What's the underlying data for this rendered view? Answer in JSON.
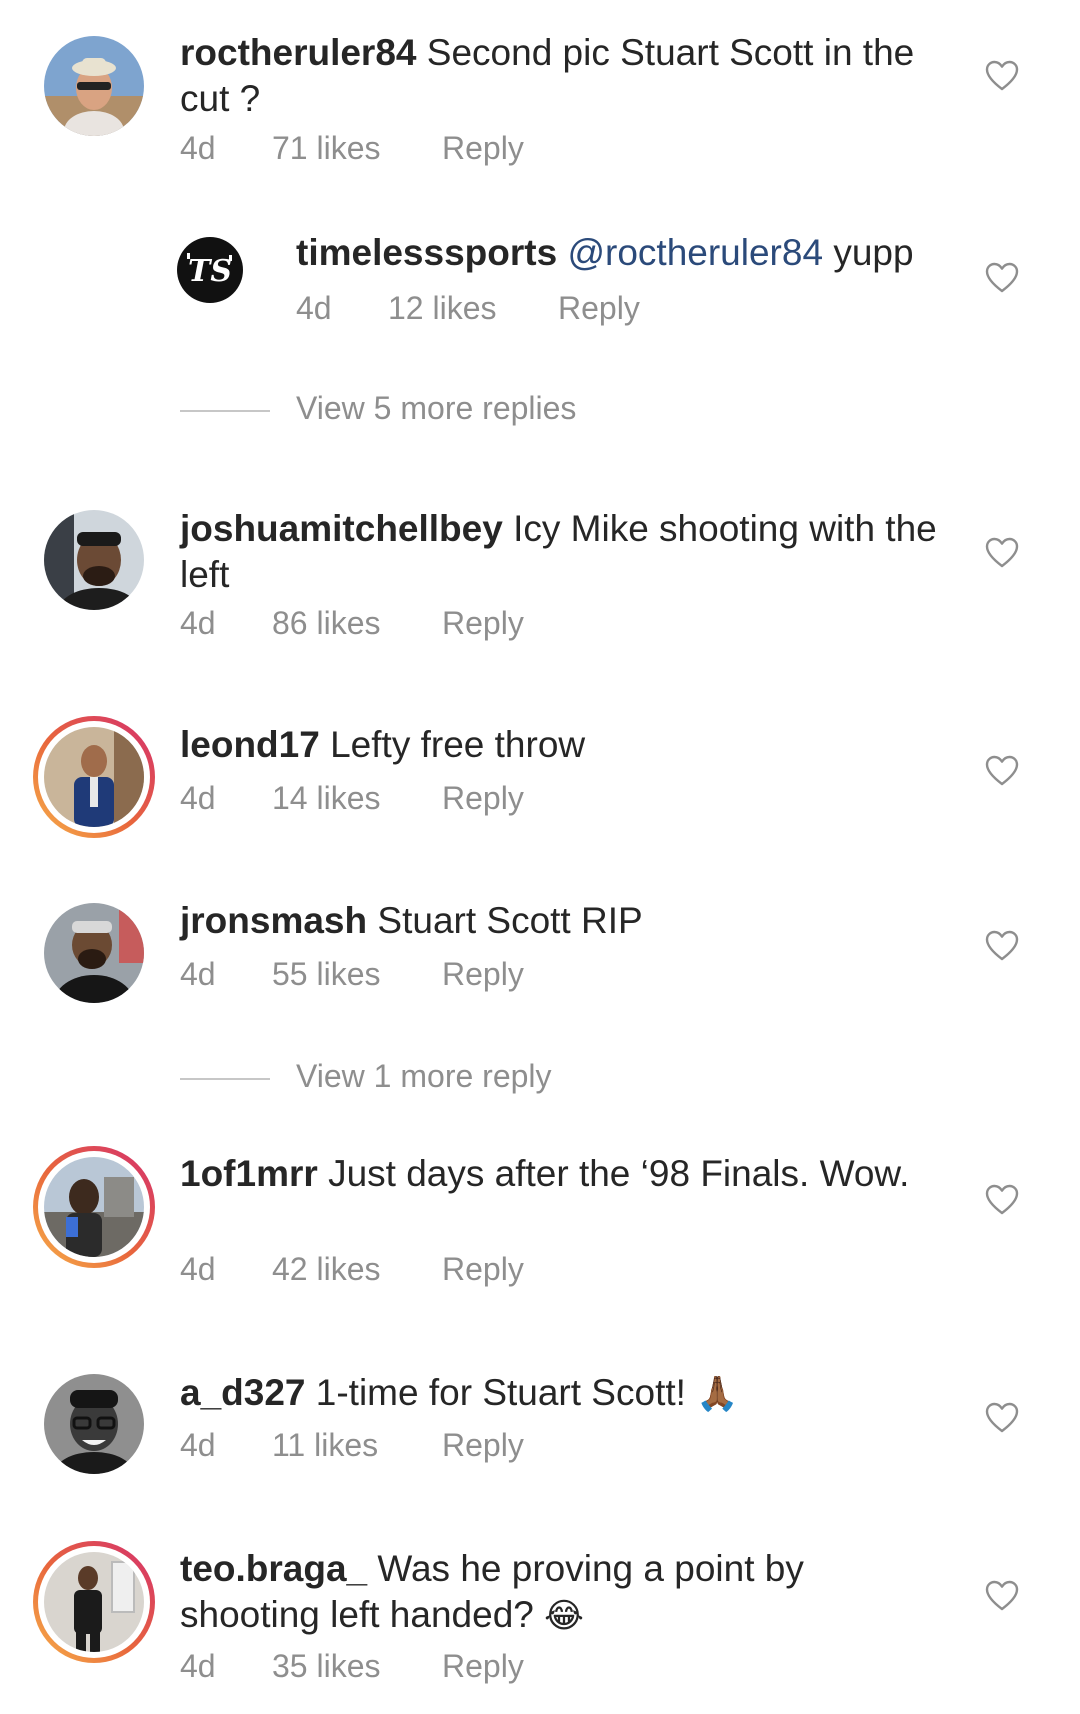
{
  "comments": [
    {
      "username": "roctheruler84",
      "text": "Second pic Stuart Scott in the cut ?",
      "time": "4d",
      "likes": "71 likes",
      "reply": "Reply",
      "replies": [
        {
          "username": "timelesssports",
          "mention": "@roctheruler84",
          "text": "yupp",
          "time": "4d",
          "likes": "12 likes",
          "reply": "Reply"
        }
      ],
      "view_more": "View 5 more replies"
    },
    {
      "username": "joshuamitchellbey",
      "text": "Icy Mike shooting with the left",
      "time": "4d",
      "likes": "86 likes",
      "reply": "Reply"
    },
    {
      "username": "leond17",
      "text": "Lefty free throw",
      "time": "4d",
      "likes": "14 likes",
      "reply": "Reply"
    },
    {
      "username": "jronsmash",
      "text": "Stuart Scott RIP",
      "time": "4d",
      "likes": "55 likes",
      "reply": "Reply",
      "view_more": "View 1 more reply"
    },
    {
      "username": "1of1mrr",
      "text": "Just days after the ‘98 Finals. Wow.",
      "time": "4d",
      "likes": "42 likes",
      "reply": "Reply"
    },
    {
      "username": "a_d327",
      "text": "1-time for Stuart Scott!",
      "emoji": "🙏🏾",
      "time": "4d",
      "likes": "11 likes",
      "reply": "Reply"
    },
    {
      "username": "teo.braga_",
      "text": "Was he proving a point by shooting left handed?",
      "emoji": "😂",
      "time": "4d",
      "likes": "35 likes",
      "reply": "Reply"
    }
  ],
  "icons": {
    "like": "heart-outline-icon"
  },
  "colors": {
    "text": "#262626",
    "secondary": "#8e8e8e",
    "mention": "#2b4a7a",
    "story_ring_start": "#f7b24a",
    "story_ring_end": "#d42f6e"
  }
}
